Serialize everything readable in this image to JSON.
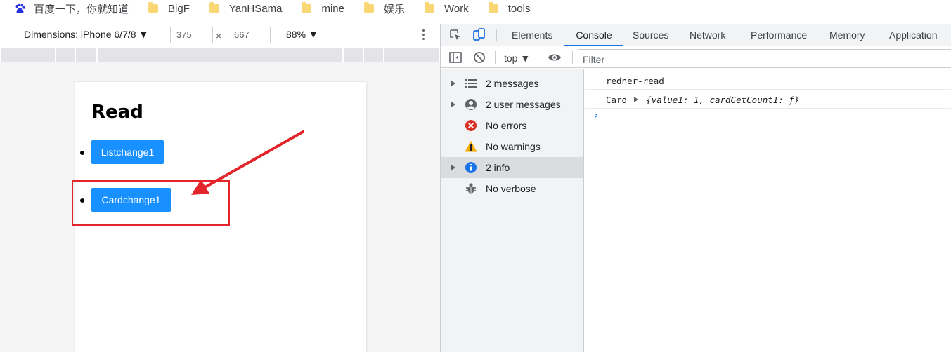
{
  "bookmarks": [
    {
      "label": "百度一下，你就知道",
      "icon": "baidu-paw-icon"
    },
    {
      "label": "BigF",
      "icon": "folder-icon"
    },
    {
      "label": "YanHSama",
      "icon": "folder-icon"
    },
    {
      "label": "mine",
      "icon": "folder-icon"
    },
    {
      "label": "娱乐",
      "icon": "folder-icon"
    },
    {
      "label": "Work",
      "icon": "folder-icon"
    },
    {
      "label": "tools",
      "icon": "folder-icon"
    }
  ],
  "device_toolbar": {
    "dimensions_label": "Dimensions: iPhone 6/7/8 ▼",
    "width": "375",
    "times": "×",
    "height": "667",
    "zoom": "88% ▼"
  },
  "page": {
    "heading": "Read",
    "buttons": [
      "Listchange1",
      "Cardchange1"
    ]
  },
  "devtools": {
    "tabs": [
      "Elements",
      "Console",
      "Sources",
      "Network",
      "Performance",
      "Memory",
      "Application"
    ],
    "active_tab": "Console",
    "context": "top ▼",
    "filter_placeholder": "Filter",
    "sidebar": [
      {
        "label": "2 messages",
        "icon": "list-icon",
        "expandable": true
      },
      {
        "label": "2 user messages",
        "icon": "user-icon",
        "expandable": true
      },
      {
        "label": "No errors",
        "icon": "error-icon",
        "expandable": false
      },
      {
        "label": "No warnings",
        "icon": "warning-icon",
        "expandable": false
      },
      {
        "label": "2 info",
        "icon": "info-icon",
        "expandable": true,
        "selected": true
      },
      {
        "label": "No verbose",
        "icon": "bug-icon",
        "expandable": false
      }
    ],
    "console_lines": [
      {
        "text": "redner-read"
      },
      {
        "prefix": "Card ",
        "object": "{value1: 1, cardGetCount1: ƒ}"
      }
    ],
    "prompt": "›"
  },
  "colors": {
    "accent": "#1a73e8",
    "button": "#1890ff",
    "annotation": "#e3242b"
  }
}
